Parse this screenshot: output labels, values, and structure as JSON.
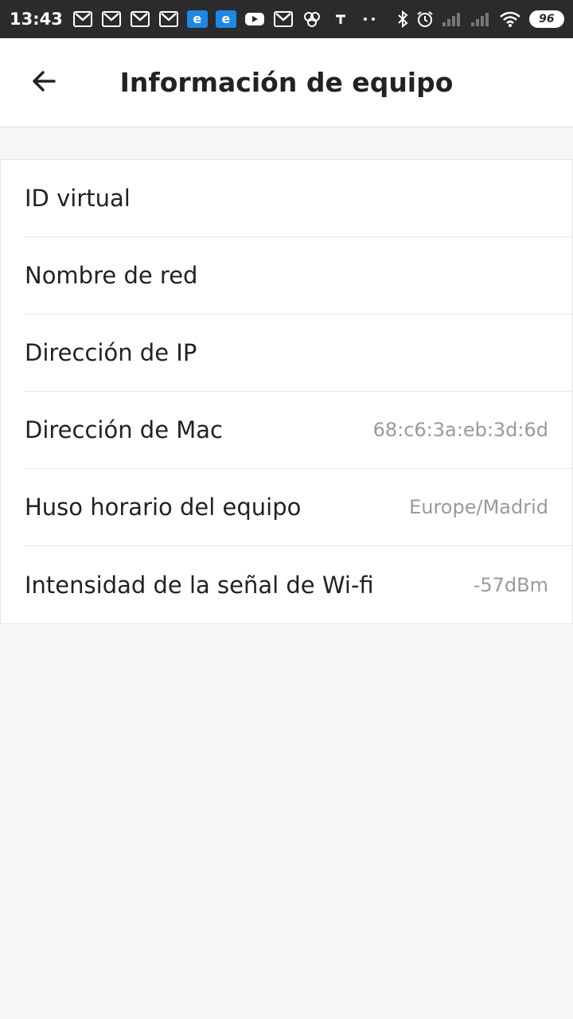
{
  "status_bar": {
    "time": "13:43",
    "battery": "96",
    "notification_icons": [
      "gmail-icon",
      "gmail-icon",
      "gmail-icon",
      "gmail-icon",
      "edge-icon",
      "edge-icon",
      "youtube-icon",
      "gmail-icon",
      "cloud-icon",
      "tiktok-icon",
      "more-dots-icon"
    ],
    "edge_letter": "e",
    "system_icons": [
      "bluetooth-icon",
      "alarm-icon",
      "signal-icon",
      "signal-icon",
      "wifi-icon",
      "battery-icon"
    ]
  },
  "header": {
    "title": "Información de equipo",
    "back_icon": "arrow-left-icon"
  },
  "info": {
    "rows": [
      {
        "label": "ID virtual",
        "value": ""
      },
      {
        "label": "Nombre de red",
        "value": ""
      },
      {
        "label": "Dirección de IP",
        "value": ""
      },
      {
        "label": "Dirección de Mac",
        "value": "68:c6:3a:eb:3d:6d"
      },
      {
        "label": "Huso horario del equipo",
        "value": "Europe/Madrid"
      },
      {
        "label": "Intensidad de la señal de Wi-fi",
        "value": "-57dBm"
      }
    ]
  },
  "colors": {
    "status_bar_bg": "#2b2b2b",
    "page_bg": "#f6f6f6",
    "card_bg": "#ffffff",
    "label_text": "#222222",
    "value_text": "#9a9a9a"
  }
}
